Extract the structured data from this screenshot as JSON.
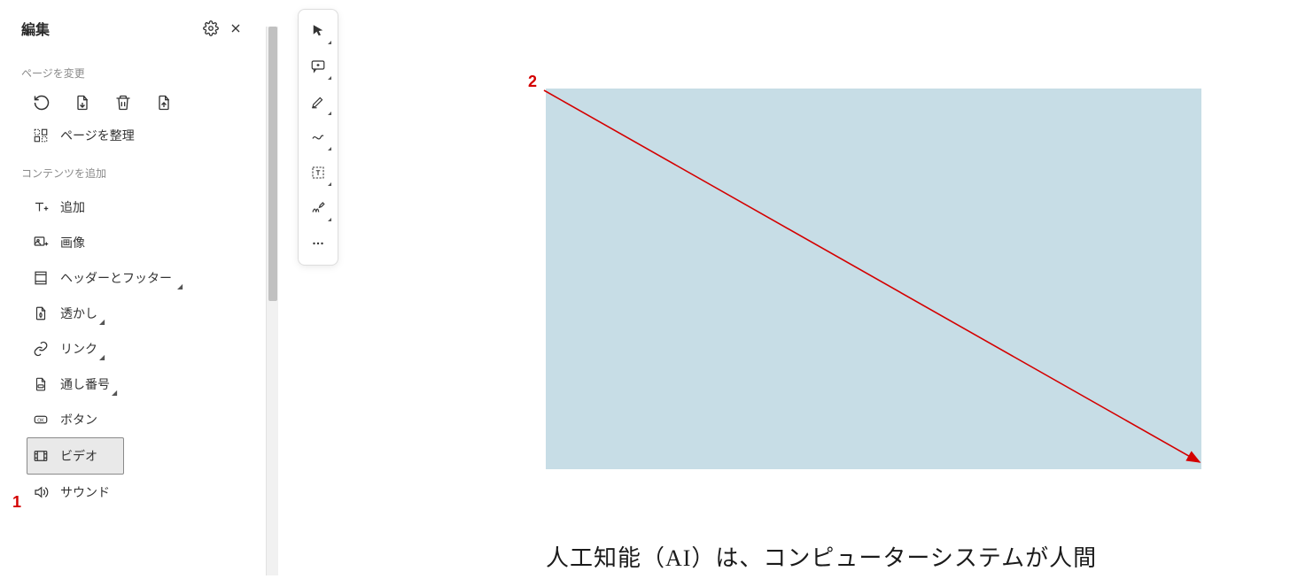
{
  "sidebar": {
    "title": "編集",
    "section_change_page": "ページを変更",
    "organize_pages": "ページを整理",
    "section_add_content": "コンテンツを追加",
    "items": {
      "add": "追加",
      "image": "画像",
      "header_footer": "ヘッダーとフッター",
      "watermark": "透かし",
      "link": "リンク",
      "serial": "通し番号",
      "button": "ボタン",
      "video": "ビデオ",
      "sound": "サウンド"
    }
  },
  "annotations": {
    "one": "1",
    "two": "2"
  },
  "document": {
    "paragraph": "人工知能（AI）は、コンピューターシステムが人間"
  }
}
